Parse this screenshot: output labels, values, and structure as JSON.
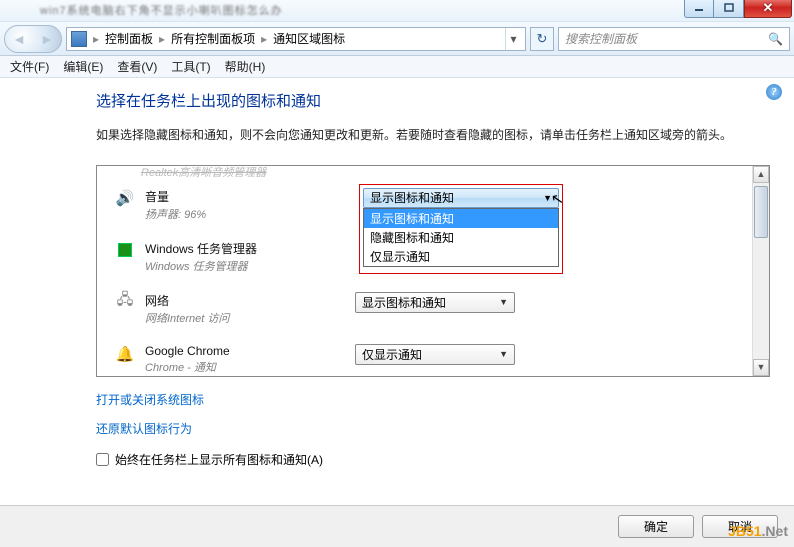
{
  "window": {
    "ghost_title": "win7系统电脑右下角不显示小喇叭图标怎么办",
    "buttons": {
      "close": "✕"
    }
  },
  "nav": {
    "root": "控制面板",
    "level2": "所有控制面板项",
    "level3": "通知区域图标",
    "search_placeholder": "搜索控制面板"
  },
  "menu": {
    "file": "文件(F)",
    "edit": "编辑(E)",
    "view": "查看(V)",
    "tools": "工具(T)",
    "help": "帮助(H)"
  },
  "page": {
    "title": "选择在任务栏上出现的图标和通知",
    "desc": "如果选择隐藏图标和通知，则不会向您通知更改和更新。若要随时查看隐藏的图标，请单击任务栏上通知区域旁的箭头。",
    "cutoff_item": "Realtek高清晰音频管理器"
  },
  "items": [
    {
      "title": "音量",
      "sub": "扬声器: 96%",
      "selected": "显示图标和通知"
    },
    {
      "title": "Windows 任务管理器",
      "sub": "Windows 任务管理器",
      "selected": ""
    },
    {
      "title": "网络",
      "sub": "网络Internet 访问",
      "selected": "显示图标和通知"
    },
    {
      "title": "Google Chrome",
      "sub": "Chrome - 通知",
      "selected": "仅显示通知"
    }
  ],
  "dropdown": {
    "current": "显示图标和通知",
    "options": [
      "显示图标和通知",
      "隐藏图标和通知",
      "仅显示通知"
    ]
  },
  "links": {
    "l1": "打开或关闭系统图标",
    "l2": "还原默认图标行为",
    "checkbox": "始终在任务栏上显示所有图标和通知(A)"
  },
  "footer": {
    "ok": "确定",
    "cancel": "取消"
  },
  "watermark": {
    "a": "JB51",
    "b": ".Net"
  }
}
